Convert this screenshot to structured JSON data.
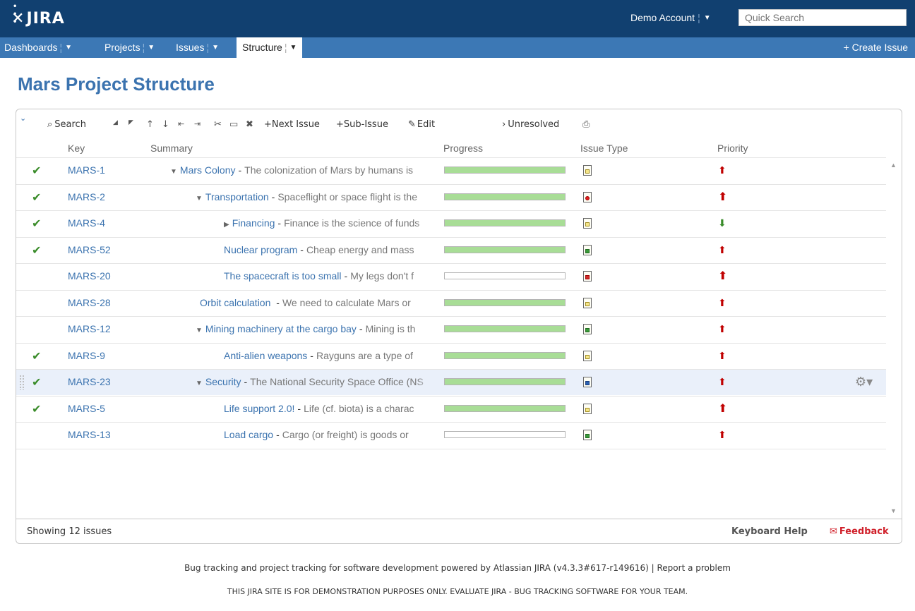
{
  "app": {
    "logo": "JIRA"
  },
  "header": {
    "account": "Demo Account",
    "search_placeholder": "Quick Search"
  },
  "nav": {
    "items": [
      {
        "label": "Dashboards"
      },
      {
        "label": "Projects"
      },
      {
        "label": "Issues"
      },
      {
        "label": "Structure",
        "active": true
      }
    ],
    "create": "+ Create Issue"
  },
  "page": {
    "title": "Mars Project Structure"
  },
  "toolbar": {
    "search": "Search",
    "next_issue": "+Next Issue",
    "sub_issue": "+Sub-Issue",
    "edit": "Edit",
    "unresolved": "Unresolved"
  },
  "columns": {
    "key": "Key",
    "summary": "Summary",
    "progress": "Progress",
    "issue_type": "Issue Type",
    "priority": "Priority"
  },
  "issues": [
    {
      "resolved": true,
      "key": "MARS-1",
      "title": "Mars Colony",
      "desc": "The colonization of Mars by humans is",
      "indent": 0,
      "twisty": "▼",
      "progress": 1.0,
      "type": "improvement",
      "priority": "major"
    },
    {
      "resolved": true,
      "key": "MARS-2",
      "title": "Transportation",
      "desc": "Spaceflight or space flight is the",
      "indent": 1,
      "twisty": "▼",
      "progress": 1.0,
      "type": "bug",
      "priority": "critical"
    },
    {
      "resolved": true,
      "key": "MARS-4",
      "title": "Financing",
      "desc": "Finance is the science of funds",
      "indent": 2,
      "twisty": "▶",
      "progress": 1.0,
      "type": "improvement",
      "priority": "minor"
    },
    {
      "resolved": true,
      "key": "MARS-52",
      "title": "Nuclear program",
      "desc": "Cheap energy and mass",
      "indent": 2,
      "twisty": "",
      "progress": 1.0,
      "type": "new-feature",
      "priority": "major"
    },
    {
      "resolved": false,
      "key": "MARS-20",
      "title": "The spacecraft is too small",
      "desc": "My legs don't f",
      "indent": 2,
      "twisty": "",
      "progress": 0.0,
      "type": "task",
      "priority": "critical"
    },
    {
      "resolved": false,
      "key": "MARS-28",
      "title": "Orbit calculation ",
      "desc": "We need to calculate Mars or",
      "indent": 1.5,
      "twisty": "",
      "progress": 1.0,
      "type": "improvement",
      "priority": "major"
    },
    {
      "resolved": false,
      "key": "MARS-12",
      "title": "Mining machinery at the cargo bay",
      "desc": "Mining is th",
      "indent": 1,
      "twisty": "▼",
      "progress": 1.0,
      "type": "new-feature",
      "priority": "major"
    },
    {
      "resolved": true,
      "key": "MARS-9",
      "title": "Anti-alien weapons",
      "desc": "Rayguns are a type of",
      "indent": 2,
      "twisty": "",
      "progress": 1.0,
      "type": "improvement",
      "priority": "major"
    },
    {
      "resolved": true,
      "key": "MARS-23",
      "title": "Security",
      "desc": "The National Security Space Office (NS",
      "indent": 1,
      "twisty": "▼",
      "progress": 1.0,
      "type": "sub-task",
      "priority": "major",
      "selected": true
    },
    {
      "resolved": true,
      "key": "MARS-5",
      "title": "Life support 2.0!",
      "desc": "Life (cf. biota) is a charac",
      "indent": 2,
      "twisty": "",
      "progress": 1.0,
      "type": "improvement",
      "priority": "critical"
    },
    {
      "resolved": false,
      "key": "MARS-13",
      "title": "Load cargo",
      "desc": "Cargo (or freight) is goods or",
      "indent": 2,
      "twisty": "",
      "progress": 0.0,
      "type": "new-feature",
      "priority": "major"
    }
  ],
  "panel_footer": {
    "showing": "Showing 12 issues",
    "keyboard_help": "Keyboard Help",
    "feedback": "Feedback"
  },
  "footer": {
    "line1": "Bug tracking and project tracking for software development powered by Atlassian JIRA (v4.3.3#617-r149616) | Report a problem",
    "line2": "THIS JIRA SITE IS FOR DEMONSTRATION PURPOSES ONLY. EVALUATE JIRA - BUG TRACKING SOFTWARE FOR YOUR TEAM."
  },
  "colors": {
    "header_bg": "#114070",
    "nav_bg": "#3c78b5",
    "link": "#3b73af",
    "progress_fill": "#a8dd96",
    "check": "#3a8c2a",
    "priority_up": "#c00000",
    "priority_down": "#3a8c2a",
    "feedback": "#d0202a"
  }
}
